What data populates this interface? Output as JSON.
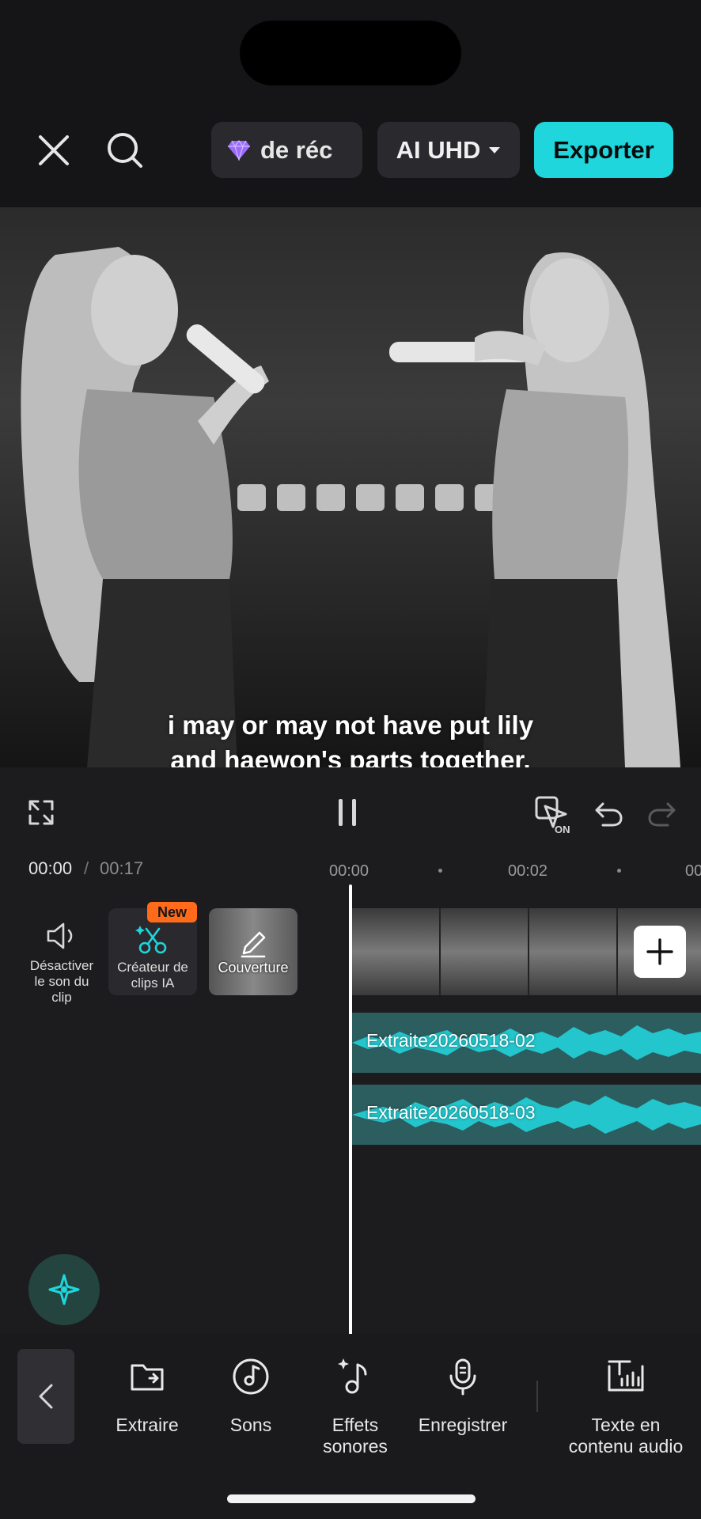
{
  "header": {
    "promo_text": "de réc",
    "quality_label": "AI UHD",
    "export_label": "Exporter"
  },
  "icons": {
    "close": "close-icon",
    "search": "search-icon",
    "diamond": "diamond-icon",
    "dropdown": "caret-down-icon"
  },
  "subtitle": {
    "text": "i may or may not have put lily and haewon's parts together."
  },
  "timeline": {
    "current_time": "00:00",
    "separator": "/",
    "total_time": "00:17",
    "ruler_labels": [
      "00:00",
      "00:02",
      "00:0"
    ]
  },
  "tools_left": {
    "mute_label": "Désactiver le son du clip",
    "ai_clip_label": "Créateur de clips IA",
    "new_badge": "New",
    "cover_label": "Couverture"
  },
  "audio_tracks": [
    {
      "name": "Extraite20260518-02"
    },
    {
      "name": "Extraite20260518-03"
    }
  ],
  "bottom_toolbar": {
    "items": [
      {
        "label": "Extraire",
        "icon": "folder-icon"
      },
      {
        "label": "Sons",
        "icon": "music-disc-icon"
      },
      {
        "label": "Effets sonores",
        "icon": "sparkle-note-icon"
      },
      {
        "label": "Enregistrer",
        "icon": "microphone-icon"
      },
      {
        "label": "Texte en contenu audio",
        "icon": "text-to-audio-icon"
      }
    ]
  },
  "colors": {
    "accent": "#1ed6dc",
    "badge": "#ff6b1a",
    "audio_wave": "#22c6cc",
    "audio_bg": "#2c5e60"
  }
}
